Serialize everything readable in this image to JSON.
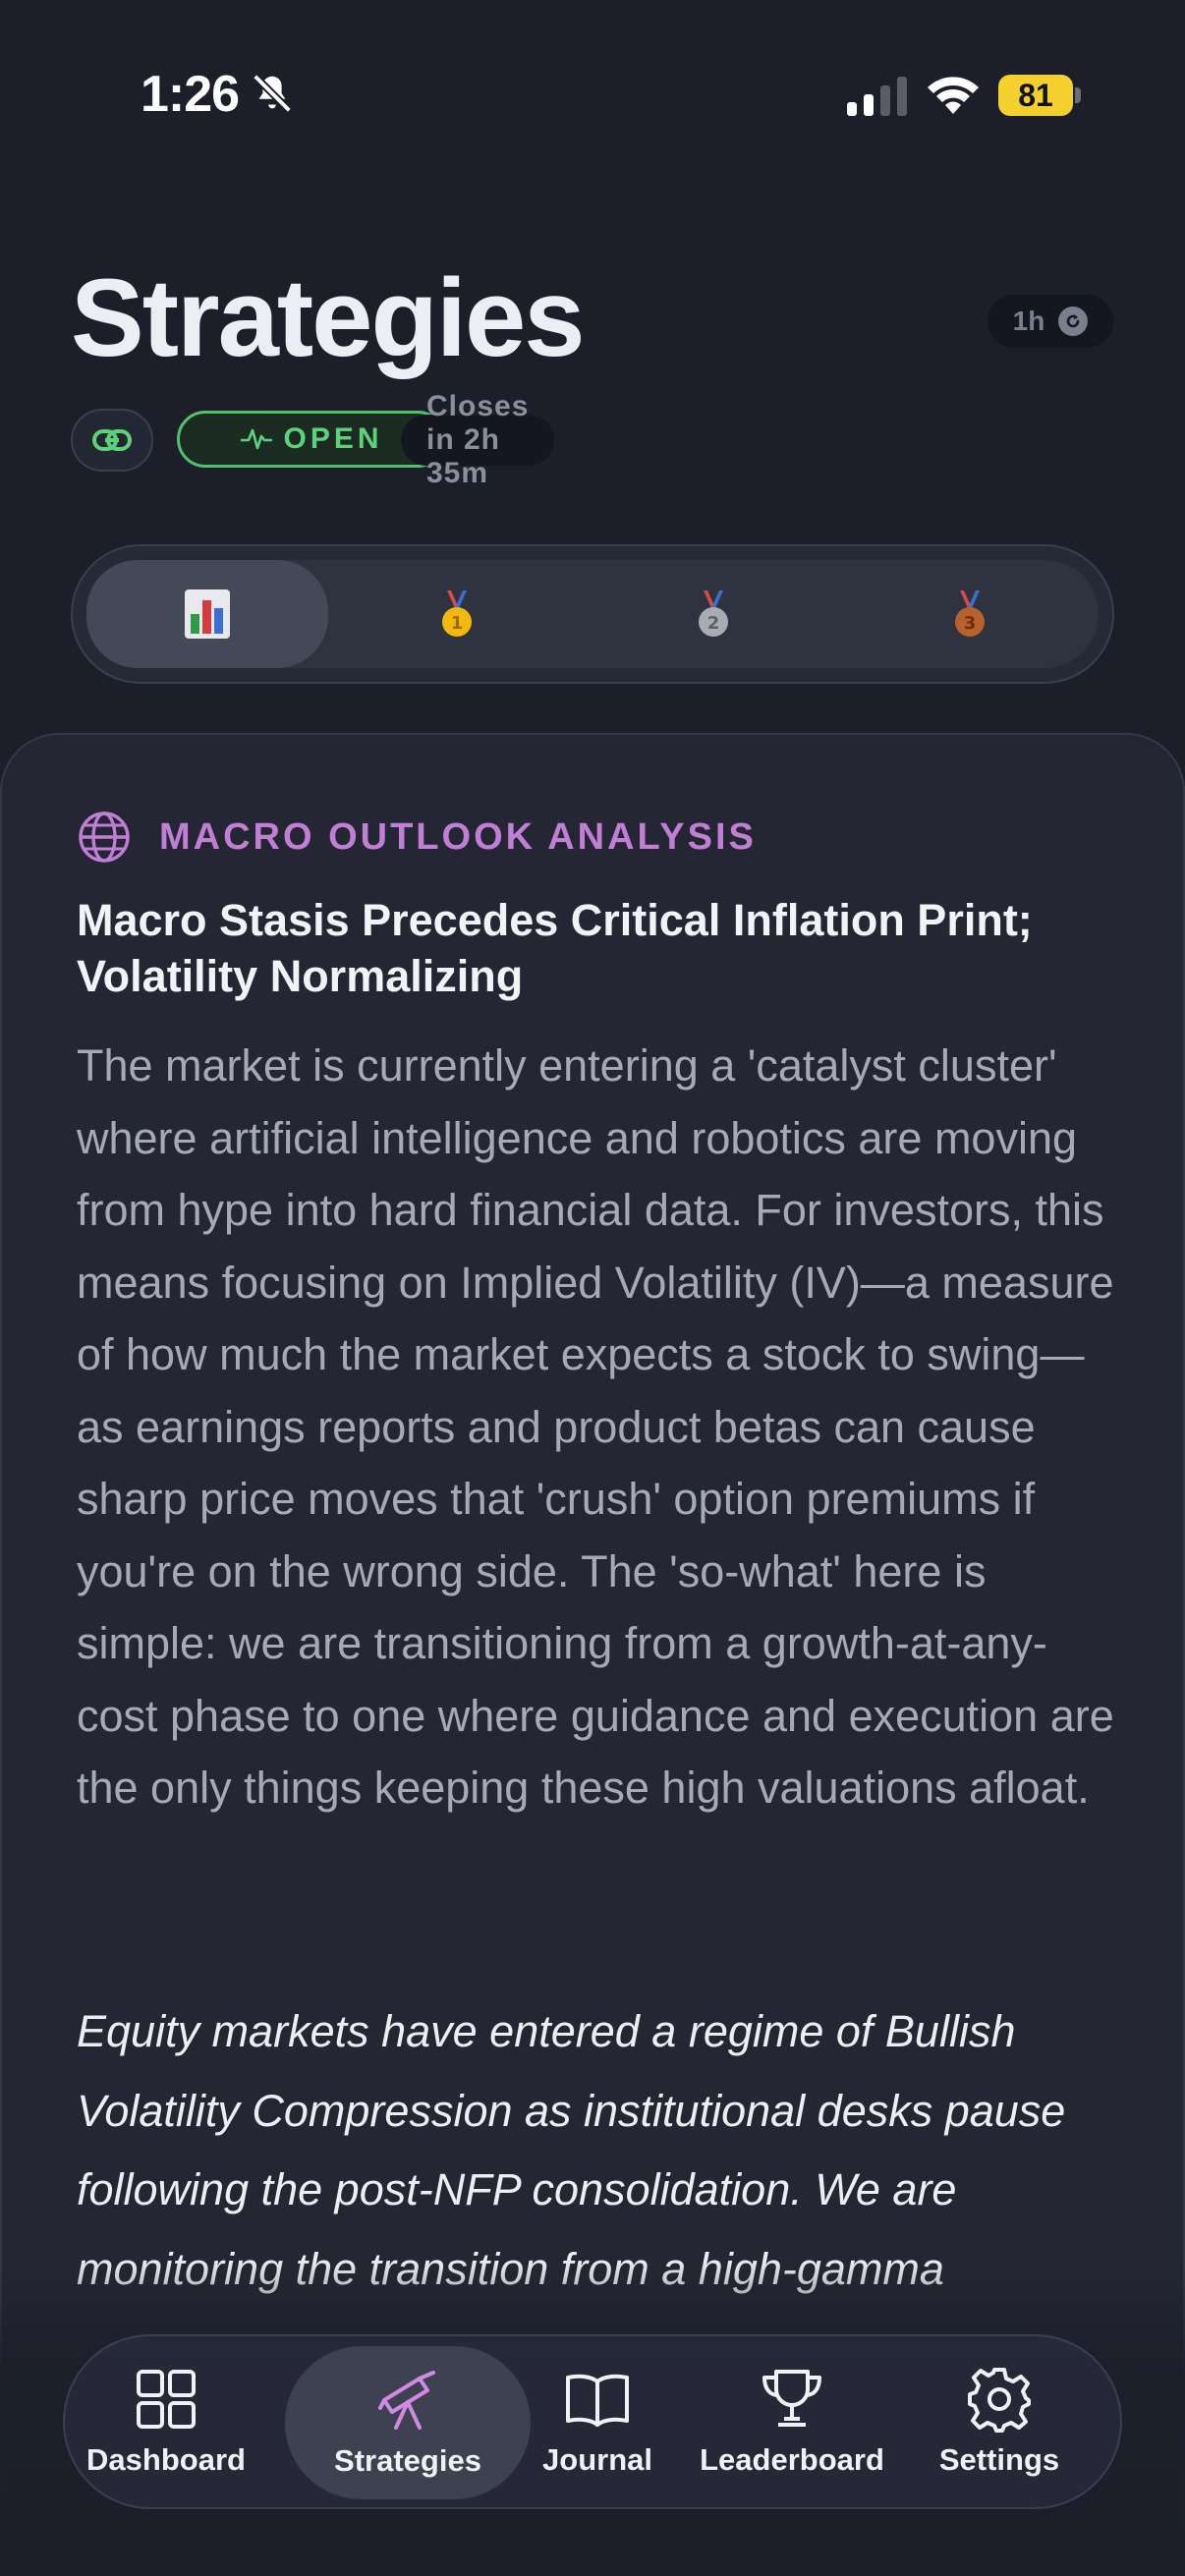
{
  "status_bar": {
    "time": "1:26",
    "battery": "81",
    "icons": [
      "bell-off-icon",
      "signal-icon",
      "wifi-icon",
      "battery-icon"
    ]
  },
  "header": {
    "title": "Strategies",
    "interval": "1h",
    "status_badge": "OPEN",
    "closes_text": "Closes in 2h 35m"
  },
  "segments": [
    {
      "icon": "bar-chart-icon",
      "active": true
    },
    {
      "icon": "gold-medal-icon",
      "label": "1",
      "active": false
    },
    {
      "icon": "silver-medal-icon",
      "label": "2",
      "active": false
    },
    {
      "icon": "bronze-medal-icon",
      "label": "3",
      "active": false
    }
  ],
  "analysis": {
    "section_label": "MACRO OUTLOOK ANALYSIS",
    "headline": "Macro Stasis Precedes Critical Inflation Print; Volatility Normalizing",
    "summary": "The market is currently entering a 'catalyst cluster' where artificial intelligence and robotics are moving from hype into hard financial data. For investors, this means focusing on Implied Volatility (IV)—a measure of how much the market expects a stock to swing—as earnings reports and product betas can cause sharp price moves that 'crush' option premiums if you're on the wrong side. The 'so-what' here is simple: we are transitioning from a growth-at-any-cost phase to one where guidance and execution are the only things keeping these high valuations afloat.",
    "detail": "Equity markets have entered a regime of Bullish Volatility Compression as institutional desks pause following the post-NFP consolidation. We are monitoring the transition from a high-gamma"
  },
  "nav": {
    "tabs": [
      {
        "label": "Dashboard",
        "icon": "grid-icon"
      },
      {
        "label": "Strategies",
        "icon": "telescope-icon",
        "active": true
      },
      {
        "label": "Journal",
        "icon": "book-icon"
      },
      {
        "label": "Leaderboard",
        "icon": "trophy-icon"
      },
      {
        "label": "Settings",
        "icon": "gear-icon"
      }
    ]
  },
  "colors": {
    "background": "#1c1f2a",
    "accent_purple": "#c07ed4",
    "open_green": "#5cd37a",
    "battery_yellow": "#f4d02f"
  }
}
